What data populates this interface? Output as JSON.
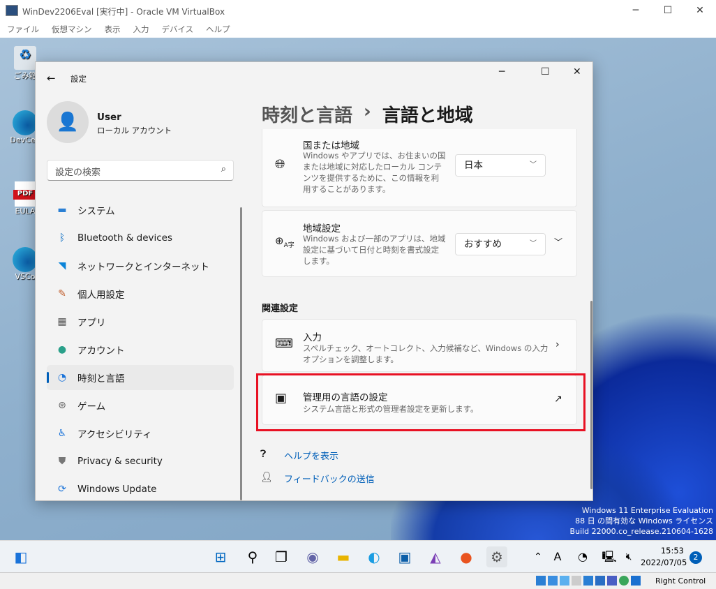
{
  "vbox": {
    "title": "WinDev2206Eval [実行中] - Oracle VM VirtualBox",
    "menu": [
      "ファイル",
      "仮想マシン",
      "表示",
      "入力",
      "デバイス",
      "ヘルプ"
    ],
    "host_key": "Right Control"
  },
  "desktop": {
    "icons": [
      "ごみ箱",
      "DevCen",
      "EULA",
      "VSCo"
    ],
    "watermark": [
      "Windows 11 Enterprise Evaluation",
      "88 日 の間有効な Windows ライセンス",
      "Build 22000.co_release.210604-1628"
    ]
  },
  "settings": {
    "app_title": "設定",
    "user": {
      "name": "User",
      "account": "ローカル アカウント"
    },
    "search_placeholder": "設定の検索",
    "nav": [
      {
        "label": "システム",
        "icon": "system-icon"
      },
      {
        "label": "Bluetooth & devices",
        "icon": "bluetooth-icon"
      },
      {
        "label": "ネットワークとインターネット",
        "icon": "wifi-icon"
      },
      {
        "label": "個人用設定",
        "icon": "brush-icon"
      },
      {
        "label": "アプリ",
        "icon": "apps-icon"
      },
      {
        "label": "アカウント",
        "icon": "account-icon"
      },
      {
        "label": "時刻と言語",
        "icon": "time-language-icon",
        "selected": true
      },
      {
        "label": "ゲーム",
        "icon": "gamepad-icon"
      },
      {
        "label": "アクセシビリティ",
        "icon": "accessibility-icon"
      },
      {
        "label": "Privacy & security",
        "icon": "shield-icon"
      },
      {
        "label": "Windows Update",
        "icon": "update-icon"
      }
    ],
    "breadcrumb": {
      "parent": "時刻と言語",
      "sep": "›",
      "current": "言語と地域"
    },
    "country": {
      "title": "国または地域",
      "desc": "Windows やアプリでは、お住まいの国または地域に対応したローカル コンテンツを提供するために、この情報を利用することがあります。",
      "value": "日本"
    },
    "regional": {
      "title": "地域設定",
      "desc": "Windows および一部のアプリは、地域設定に基づいて日付と時刻を書式設定します。",
      "value": "おすすめ"
    },
    "related_header": "関連設定",
    "typing": {
      "title": "入力",
      "desc": "スペルチェック、オートコレクト、入力候補など、Windows の入力オプションを調整します。"
    },
    "admin": {
      "title": "管理用の言語の設定",
      "desc": "システム言語と形式の管理者設定を更新します。"
    },
    "links": {
      "help": "ヘルプを表示",
      "feedback": "フィードバックの送信"
    }
  },
  "taskbar": {
    "time": "15:53",
    "date": "2022/07/05",
    "notifications": "2",
    "ime": "A"
  },
  "colors": {
    "accent": "#005fb8",
    "highlight": "#e81123"
  }
}
